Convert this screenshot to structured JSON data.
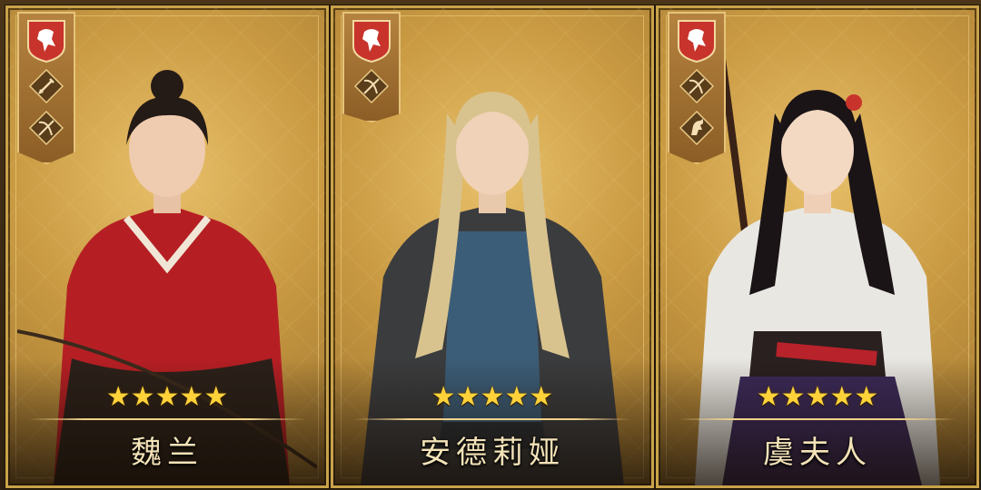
{
  "cards": [
    {
      "name": "魏兰",
      "stars": "★★★★★",
      "crest_icon": "lion-crest-icon",
      "skills": [
        "sword-icon",
        "bow-icon"
      ],
      "outfit_color": "#b51f24"
    },
    {
      "name": "安德莉娅",
      "stars": "★★★★★",
      "crest_icon": "lion-crest-icon",
      "skills": [
        "bow-icon"
      ],
      "outfit_color": "#3c5d78"
    },
    {
      "name": "虞夫人",
      "stars": "★★★★★",
      "crest_icon": "lion-crest-icon",
      "skills": [
        "bow-icon",
        "horse-icon"
      ],
      "outfit_color": "#e9e7e2"
    }
  ],
  "colors": {
    "frame": "#c9a24a",
    "star": "#ffd23a",
    "crest_red": "#c8332b"
  }
}
